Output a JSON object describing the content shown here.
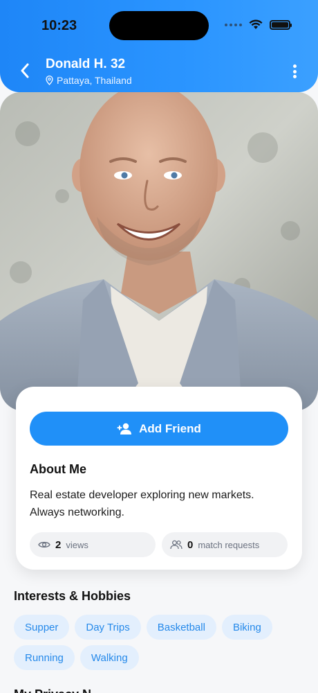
{
  "status_bar": {
    "time": "10:23"
  },
  "header": {
    "title": "Donald H. 32",
    "location": "Pattaya, Thailand"
  },
  "profile_card": {
    "add_friend_label": "Add Friend",
    "about_title": "About Me",
    "about_text": "Real estate developer exploring new markets. Always networking.",
    "stats": {
      "views_count": "2",
      "views_label": "views",
      "requests_count": "0",
      "requests_label": "match requests"
    }
  },
  "interests": {
    "title": "Interests & Hobbies",
    "items": [
      "Supper",
      "Day Trips",
      "Basketball",
      "Biking",
      "Running",
      "Walking"
    ]
  },
  "next_section": {
    "title": "My Privacy N..."
  },
  "colors": {
    "accent": "#2090f8",
    "chip_bg": "#e3effd",
    "chip_text": "#2589ea"
  },
  "icons": [
    "chevron-left-icon",
    "location-pin-icon",
    "more-vertical-icon",
    "add-user-icon",
    "eye-icon",
    "users-icon",
    "wifi-icon",
    "battery-icon",
    "signal-icon"
  ]
}
